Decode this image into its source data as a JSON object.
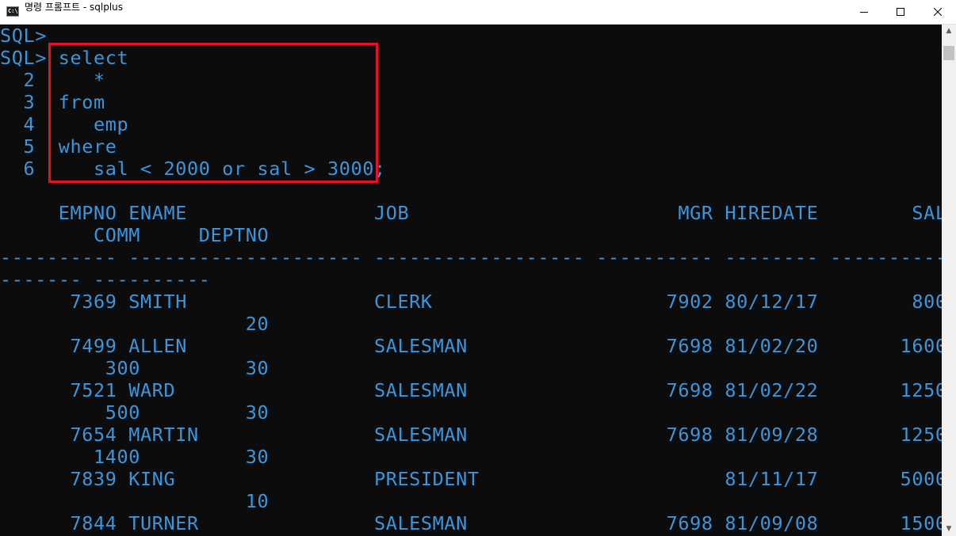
{
  "window": {
    "title": "명령 프롬프트 - sqlplus",
    "icon_text": "C:\\"
  },
  "console": {
    "lines": [
      "SQL>",
      "SQL> select",
      "  2     *",
      "  3  from",
      "  4     emp",
      "  5  where",
      "  6     sal < 2000 or sal > 3000;",
      "",
      "     EMPNO ENAME                JOB                       MGR HIREDATE        SAL",
      "        COMM     DEPTNO",
      "---------- -------------------- ------------------ ---------- -------- ---------- ---",
      "------- ----------",
      "      7369 SMITH                CLERK                    7902 80/12/17        800",
      "                     20",
      "      7499 ALLEN                SALESMAN                 7698 81/02/20       1600",
      "         300         30",
      "      7521 WARD                 SALESMAN                 7698 81/02/22       1250",
      "         500         30",
      "      7654 MARTIN               SALESMAN                 7698 81/09/28       1250",
      "        1400         30",
      "      7839 KING                 PRESIDENT                     81/11/17       5000",
      "                     10",
      "      7844 TURNER               SALESMAN                 7698 81/09/08       1500"
    ]
  },
  "scrollbar": {
    "up_arrow": "▲",
    "down_arrow": "▼"
  }
}
